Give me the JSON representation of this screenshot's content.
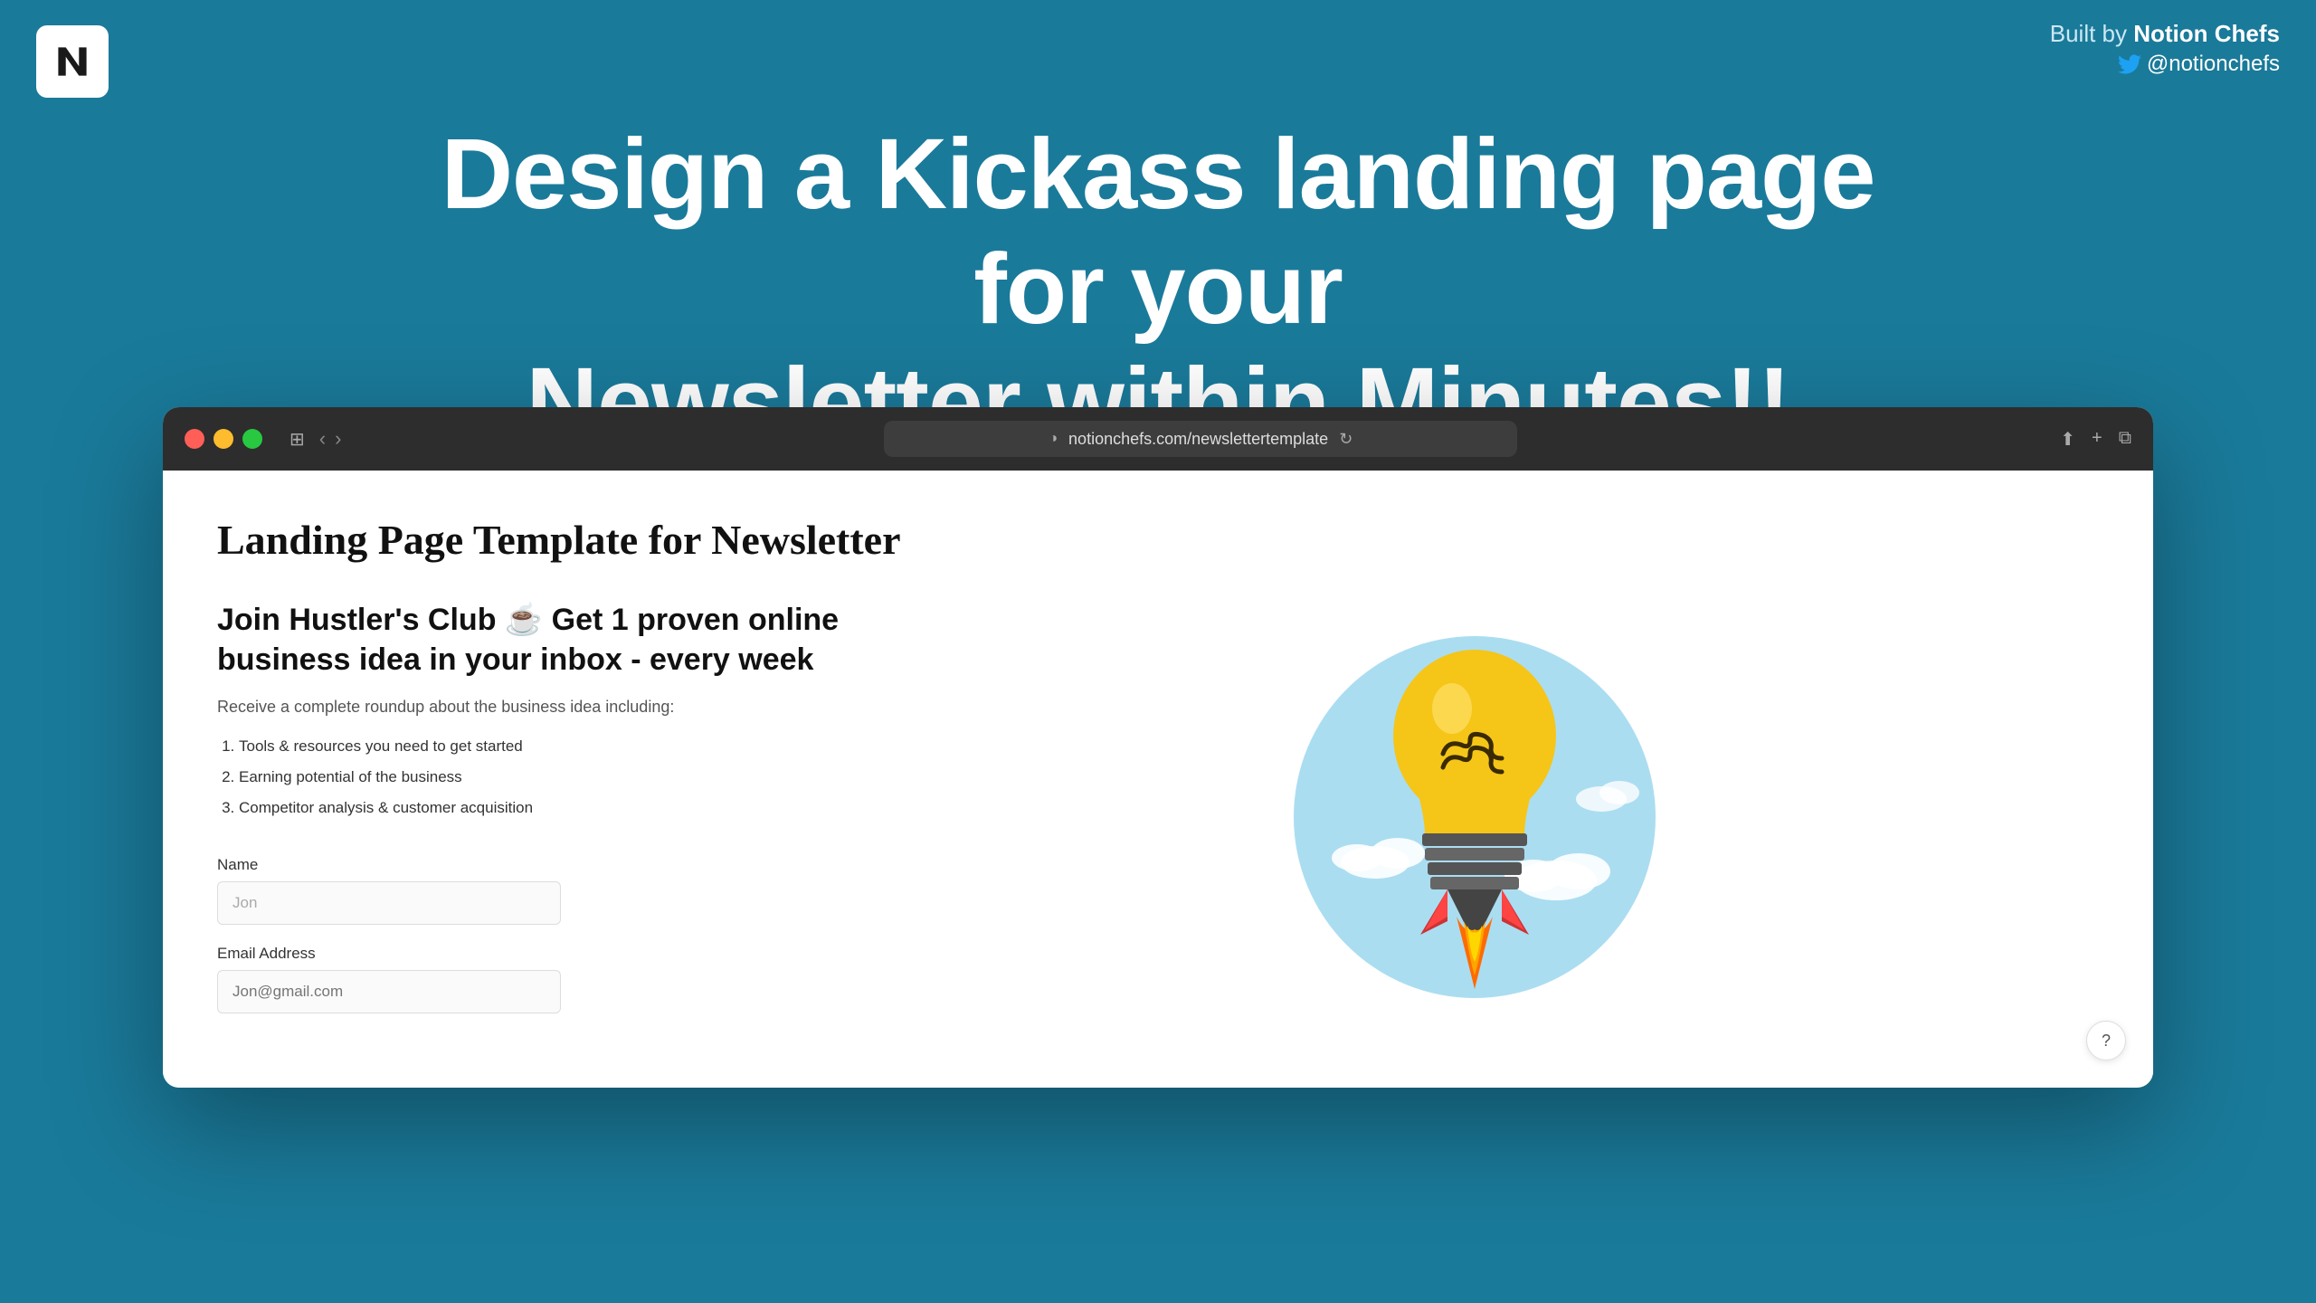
{
  "brand": {
    "notion_logo_alt": "Notion Logo",
    "built_by_prefix": "Built by ",
    "built_by_name": "Notion Chefs",
    "twitter_handle": "@notionchefs"
  },
  "headline": {
    "line1": "Design a Kickass landing page for your",
    "line2": "Newsletter within Minutes!!"
  },
  "browser": {
    "url": "notionchefs.com/newslettertemplate",
    "traffic_lights": [
      "red",
      "yellow",
      "green"
    ],
    "page_title": "Landing Page Template for Newsletter",
    "newsletter_heading": "Join Hustler's Club ☕ Get 1 proven online business idea in your inbox - every week",
    "description": "Receive a complete roundup about the business idea including:",
    "list_items": [
      "Tools & resources you need to get started",
      "Earning potential of the business",
      "Competitor analysis & customer acquisition"
    ],
    "form": {
      "name_label": "Name",
      "name_placeholder": "Jon",
      "email_label": "Email Address",
      "email_placeholder": "Jon@gmail.com"
    }
  },
  "help_button_label": "?"
}
